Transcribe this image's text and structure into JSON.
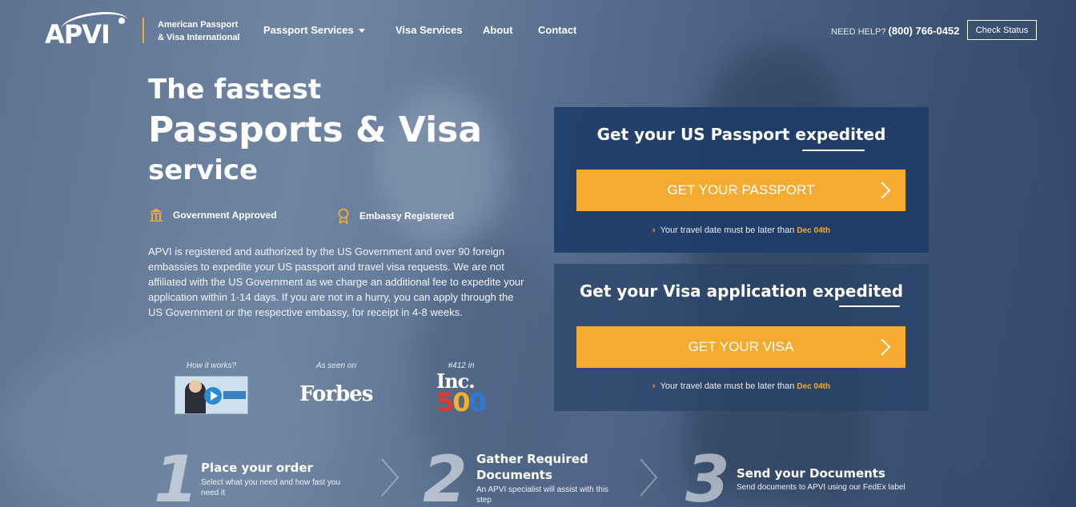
{
  "brand": {
    "logo_text": "APVI",
    "company_line1": "American Passport",
    "company_line2": "& Visa International"
  },
  "nav": {
    "items": [
      {
        "label": "Passport Services",
        "has_dropdown": true
      },
      {
        "label": "Visa Services"
      },
      {
        "label": "About"
      },
      {
        "label": "Contact"
      }
    ]
  },
  "help": {
    "label": "NEED HELP?",
    "phone": "(800) 766-0452",
    "check_status": "Check Status"
  },
  "hero": {
    "line1": "The fastest",
    "line2": "Passports & Visa",
    "line3": "service"
  },
  "badges": [
    {
      "icon": "government-building-icon",
      "label": "Government Approved"
    },
    {
      "icon": "award-ribbon-icon",
      "label": "Embassy Registered"
    }
  ],
  "description": "APVI is registered and authorized by the US Government and over 90 foreign embassies to expedite your US passport and travel visa requests. We are not affiliated with the US Government as we charge an additional fee to expedite your application within 1-14 days. If you are not in a hurry, you can apply through the US Government or the respective embassy, for receipt in 4-8 weeks.",
  "promo": {
    "how_it_works": "How it works?",
    "as_seen_on": "As seen on",
    "forbes": "Forbes",
    "inc_rank": "#412 in",
    "inc_word": "Inc.",
    "inc_500": [
      "5",
      "0",
      "0"
    ]
  },
  "passport_card": {
    "title": "Get your US Passport expedited",
    "button": "GET YOUR PASSPORT",
    "note": "Your travel date must be later than",
    "date": "Dec 04th"
  },
  "visa_card": {
    "title": "Get your Visa application expedited",
    "button": "GET YOUR VISA",
    "note": "Your travel date must be later than",
    "date": "Dec 04th"
  },
  "steps": [
    {
      "num": "1",
      "title": "Place your order",
      "text": "Select what you need and how fast you need it"
    },
    {
      "num": "2",
      "title": "Gather Required Documents",
      "text": "An APVI specialist will assist with this step"
    },
    {
      "num": "3",
      "title": "Send your Documents",
      "text": "Send documents to APVI using our FedEx label"
    }
  ],
  "colors": {
    "accent": "#f5ab2f",
    "card_bg": "#1e3c69",
    "background": "#5d7290"
  }
}
